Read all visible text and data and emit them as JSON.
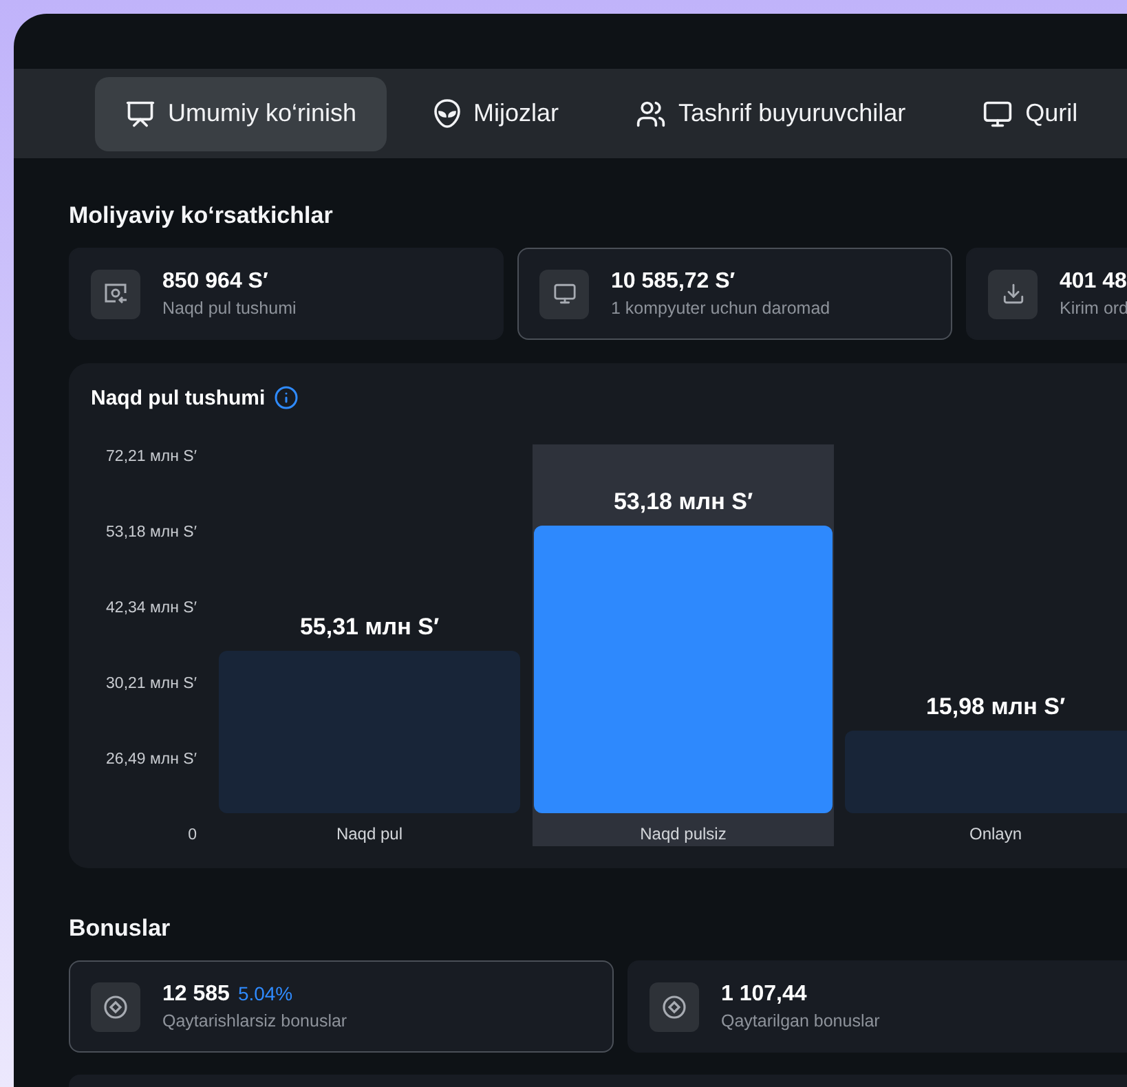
{
  "tabs": [
    {
      "label": "Umumiy ko‘rinish",
      "selected": true
    },
    {
      "label": "Mijozlar",
      "selected": false
    },
    {
      "label": "Tashrif buyuruvchilar",
      "selected": false
    },
    {
      "label": "Quril",
      "selected": false
    }
  ],
  "financial": {
    "title": "Moliyaviy ko‘rsatkichlar",
    "cards": [
      {
        "value": "850 964 S′",
        "label": "Naqd pul tushumi",
        "selected": false
      },
      {
        "value": "10 585,72 S′",
        "label": "1 kompyuter uchun daromad",
        "selected": true
      },
      {
        "value": "401 48",
        "label": "Kirim ord",
        "selected": false
      }
    ]
  },
  "cash_chart": {
    "title": "Naqd pul tushumi",
    "axis_labels": [
      "72,21 млн S′",
      "53,18 млн S′",
      "42,34 млн S′",
      "30,21 млн S′",
      "26,49 млн S′",
      "0"
    ],
    "bars": [
      {
        "category": "Naqd pul",
        "value_label": "55,31 млн S′",
        "selected": false
      },
      {
        "category": "Naqd pulsiz",
        "value_label": "53,18 млн S′",
        "selected": true
      },
      {
        "category": "Onlayn",
        "value_label": "15,98 млн S′",
        "selected": false
      }
    ]
  },
  "bonuses": {
    "title": "Bonuslar",
    "cards": [
      {
        "value": "12 585",
        "change": "5.04%",
        "label": "Qaytarishlarsiz bonuslar",
        "selected": true
      },
      {
        "value": "1 107,44",
        "label": "Qaytarilgan bonuslar",
        "selected": false
      }
    ]
  }
}
